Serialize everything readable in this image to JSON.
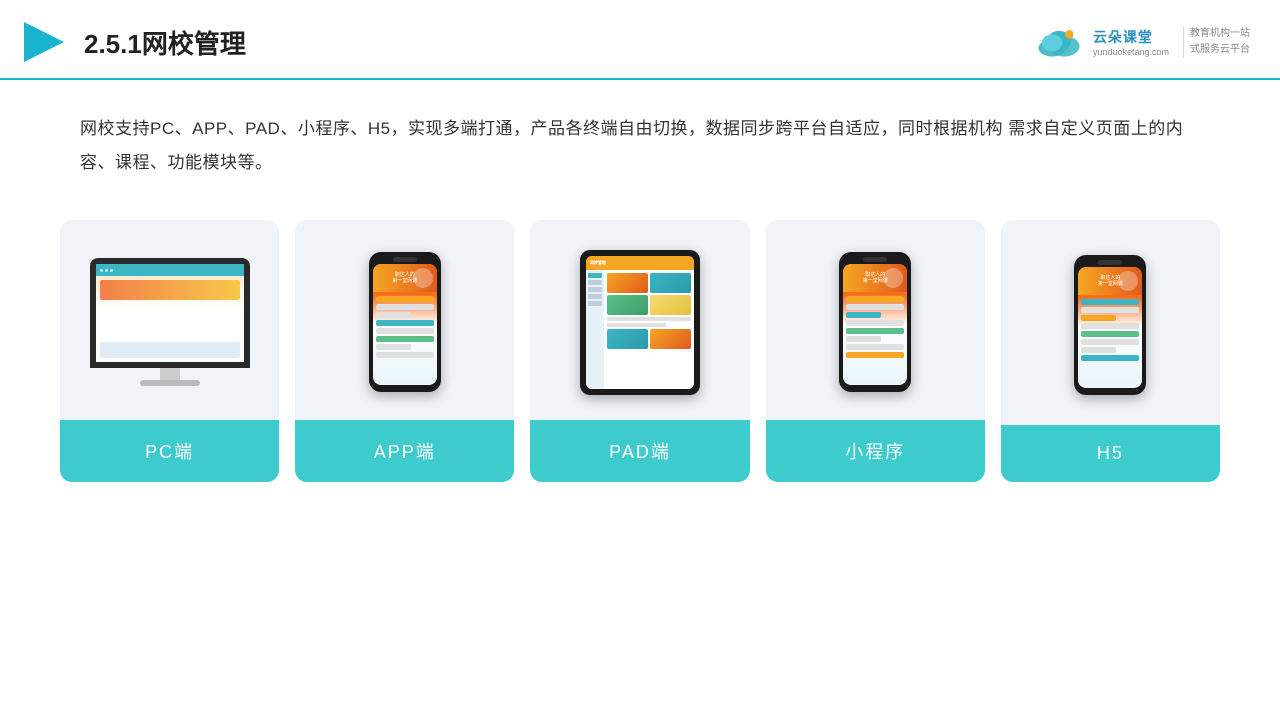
{
  "header": {
    "title": "2.5.1网校管理",
    "logo": {
      "name": "云朵课堂",
      "url": "yunduoketang.com",
      "slogan": "教育机构一站\n式服务云平台"
    }
  },
  "description": {
    "text": "网校支持PC、APP、PAD、小程序、H5，实现多端打通，产品各终端自由切换，数据同步跨平台自适应，同时根据机构\n需求自定义页面上的内容、课程、功能模块等。"
  },
  "cards": [
    {
      "id": "pc",
      "label": "PC端",
      "type": "monitor"
    },
    {
      "id": "app",
      "label": "APP端",
      "type": "phone"
    },
    {
      "id": "pad",
      "label": "PAD端",
      "type": "tablet"
    },
    {
      "id": "mini",
      "label": "小程序",
      "type": "phone"
    },
    {
      "id": "h5",
      "label": "H5",
      "type": "phone"
    }
  ],
  "colors": {
    "accent": "#3dcbce",
    "header_line": "#1ab3d0",
    "card_bg": "#f0f4f8",
    "text_dark": "#333333",
    "logo_blue": "#2b8fbd"
  }
}
